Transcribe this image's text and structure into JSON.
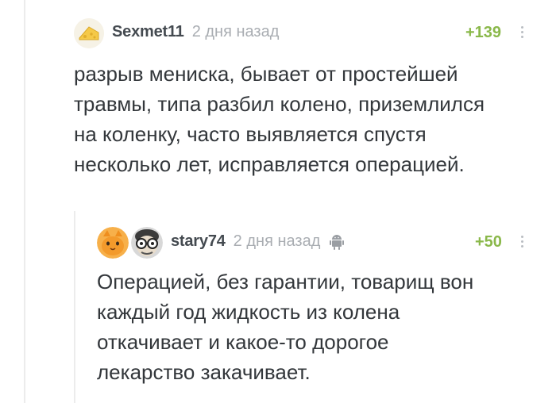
{
  "comments": [
    {
      "username": "Sexmet11",
      "time": "2 дня назад",
      "rating": "+139",
      "lines": [
        "разрыв мениска, бывает от простейшей",
        "травмы, типа разбил колено, приземлился",
        "на коленку, часто выявляется спустя",
        "несколько лет, исправляется операцией."
      ],
      "avatar_icon": "cheese-avatar-icon"
    },
    {
      "username": "stary74",
      "time": "2 дня назад",
      "rating": "+50",
      "lines": [
        "Операцией, без гарантии, товарищ вон",
        "каждый год жидкость из колена",
        "откачивает и какое-то дорогое",
        "лекарство закачивает."
      ],
      "avatar_icon": "old-man-glasses-avatar-icon",
      "parent_avatar_icon": "orange-cat-avatar-icon",
      "platform_icon": "android-icon"
    }
  ],
  "colors": {
    "rating": "#8ab84a",
    "username": "#444a50",
    "time": "#a9adb2",
    "text": "#33373b",
    "thread_line": "#ececec"
  }
}
